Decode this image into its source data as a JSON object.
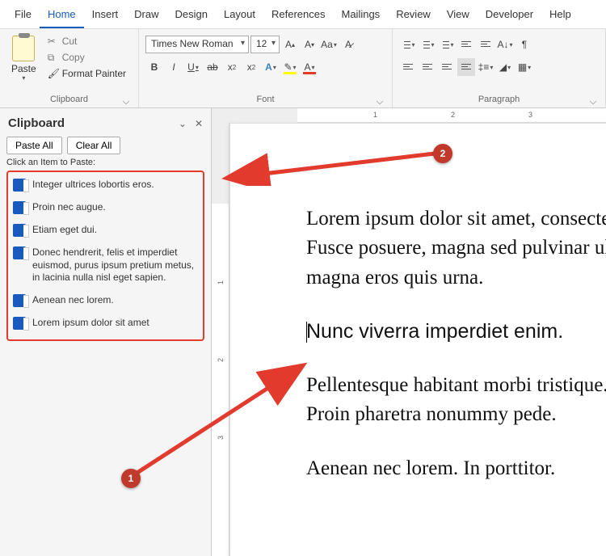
{
  "menubar": [
    "File",
    "Home",
    "Insert",
    "Draw",
    "Design",
    "Layout",
    "References",
    "Mailings",
    "Review",
    "View",
    "Developer",
    "Help"
  ],
  "menubar_active": 1,
  "ribbon": {
    "clipboard": {
      "label": "Clipboard",
      "paste": "Paste",
      "cut": "Cut",
      "copy": "Copy",
      "format_painter": "Format Painter"
    },
    "font": {
      "label": "Font",
      "family": "Times New Roman",
      "size": "12"
    },
    "paragraph": {
      "label": "Paragraph"
    }
  },
  "sidepane": {
    "title": "Clipboard",
    "paste_all": "Paste All",
    "clear_all": "Clear All",
    "hint": "Click an Item to Paste:",
    "items": [
      "Integer ultrices lobortis eros.",
      "Proin nec augue.",
      "Etiam eget dui.",
      "Donec hendrerit, felis et imperdiet euismod, purus ipsum pretium metus, in lacinia nulla nisl eget sapien.",
      "Aenean nec lorem.",
      "Lorem ipsum dolor sit amet"
    ]
  },
  "document": {
    "p1": "Lorem ipsum dolor sit amet, consectetuer adipiscing elit.",
    "p2": "Fusce posuere, magna sed pulvinar ultricies.",
    "p3": "magna eros quis urna.",
    "p4": "Nunc viverra imperdiet enim.",
    "p5": "Pellentesque habitant morbi tristique.",
    "p6": "Proin pharetra nonummy pede.",
    "p7": "Aenean nec lorem. In porttitor."
  },
  "ruler_numbers": [
    "1",
    "2",
    "3"
  ],
  "vruler_numbers": [
    "1",
    "2",
    "3"
  ],
  "annotations": {
    "badge1": "1",
    "badge2": "2"
  }
}
